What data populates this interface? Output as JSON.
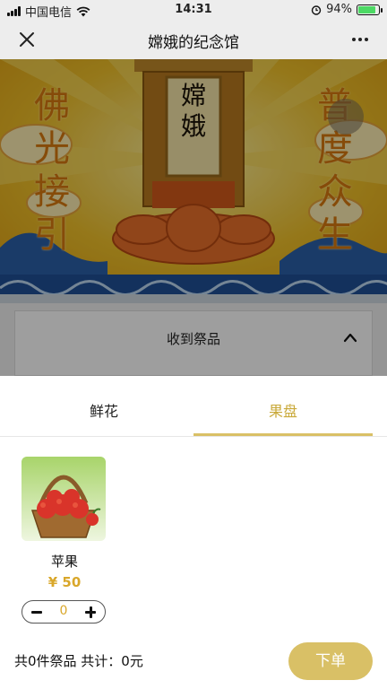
{
  "status_bar": {
    "carrier": "中国电信",
    "time": "14:31",
    "battery": "94%",
    "battery_level": 0.94
  },
  "nav": {
    "title": "嫦娥的纪念馆",
    "close_icon": "close-icon",
    "more_icon": "more-icon"
  },
  "memorial": {
    "tablet_name": "嫦娥",
    "couplet_left": "佛光接引",
    "couplet_right": "普度众生"
  },
  "received": {
    "label": "收到祭品"
  },
  "tabs": [
    {
      "label": "鲜花",
      "active": false
    },
    {
      "label": "果盘",
      "active": true
    }
  ],
  "products": [
    {
      "name": "苹果",
      "price": "¥ 50",
      "quantity": "0"
    }
  ],
  "footer": {
    "summary": "共0件祭品 共计：0元",
    "order_label": "下单"
  },
  "colors": {
    "accent": "#d9c066",
    "price": "#d9a72a",
    "active_tab": "#c9a93a"
  }
}
